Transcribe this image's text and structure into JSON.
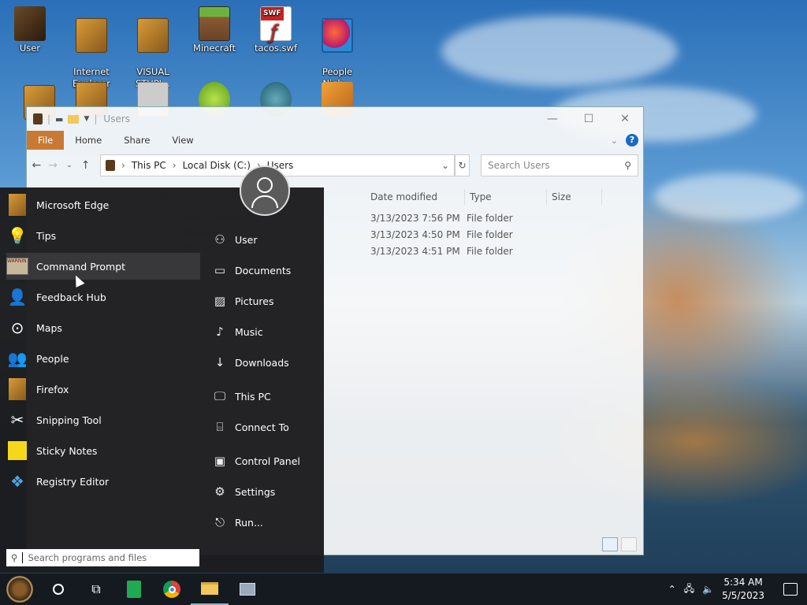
{
  "desktop": {
    "icons": [
      {
        "label": "User",
        "icon": "user-folder-icon"
      },
      {
        "label": "Internet\nExplorer",
        "icon": "book-icon"
      },
      {
        "label": "VISUAL\nSTUPI...",
        "icon": "book-icon"
      },
      {
        "label": "Minecraft",
        "icon": "minecraft-icon"
      },
      {
        "label": "tacos.swf",
        "icon": "swf-file-icon"
      },
      {
        "label": "People\nNigh...",
        "icon": "p-logo-icon"
      }
    ]
  },
  "explorer": {
    "title": "Users",
    "ribbon_tabs": [
      "File",
      "Home",
      "Share",
      "View"
    ],
    "breadcrumb": [
      "This PC",
      "Local Disk (C:)",
      "Users"
    ],
    "search_placeholder": "Search Users",
    "columns": [
      "Date modified",
      "Type",
      "Size"
    ],
    "rows": [
      {
        "date": "3/13/2023 7:56 PM",
        "type": "File folder"
      },
      {
        "date": "3/13/2023 4:50 PM",
        "type": "File folder"
      },
      {
        "date": "3/13/2023 4:51 PM",
        "type": "File folder"
      }
    ]
  },
  "start_menu": {
    "programs": [
      {
        "label": "Microsoft Edge",
        "icon": "book-icon"
      },
      {
        "label": "Tips",
        "icon": "lightbulb-icon"
      },
      {
        "label": "Command Prompt",
        "icon": "command-prompt-icon"
      },
      {
        "label": "Feedback Hub",
        "icon": "feedback-icon"
      },
      {
        "label": "Maps",
        "icon": "maps-icon"
      },
      {
        "label": "People",
        "icon": "people-icon"
      },
      {
        "label": "Firefox",
        "icon": "book-icon"
      },
      {
        "label": "Snipping Tool",
        "icon": "scissors-icon"
      },
      {
        "label": "Sticky Notes",
        "icon": "sticky-note-icon"
      },
      {
        "label": "Registry Editor",
        "icon": "registry-icon"
      }
    ],
    "places": [
      {
        "label": "User",
        "icon": "user-icon"
      },
      {
        "label": "Documents",
        "icon": "document-icon"
      },
      {
        "label": "Pictures",
        "icon": "picture-icon"
      },
      {
        "label": "Music",
        "icon": "music-icon"
      },
      {
        "label": "Downloads",
        "icon": "download-icon"
      },
      {
        "label": "This PC",
        "icon": "computer-icon"
      },
      {
        "label": "Connect To",
        "icon": "connect-icon"
      },
      {
        "label": "Control Panel",
        "icon": "control-panel-icon"
      },
      {
        "label": "Settings",
        "icon": "gear-icon"
      },
      {
        "label": "Run...",
        "icon": "run-icon"
      }
    ],
    "search_placeholder": "Search programs and files"
  },
  "taskbar": {
    "time": "5:34 AM",
    "date": "5/5/2023"
  }
}
